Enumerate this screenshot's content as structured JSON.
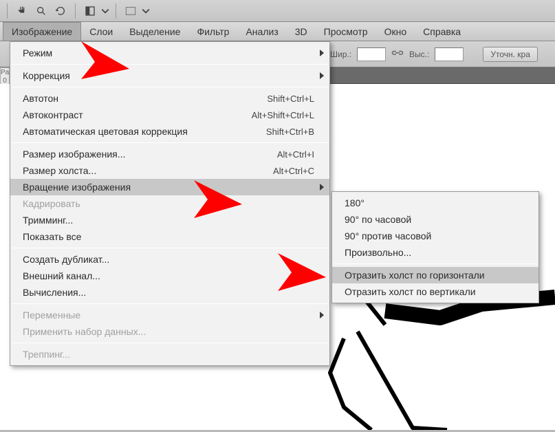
{
  "toolbar_icons": [
    "hand",
    "zoom",
    "rotate-view",
    "sep",
    "screen-mode",
    "chevron",
    "sep",
    "arrange",
    "chevron"
  ],
  "menubar": {
    "items": [
      "Изображение",
      "Слои",
      "Выделение",
      "Фильтр",
      "Анализ",
      "3D",
      "Просмотр",
      "Окно",
      "Справка"
    ],
    "active_index": 0
  },
  "options_bar": {
    "width_label": "Шир.:",
    "height_label": "Выс.:",
    "refine_button": "Уточн. кра"
  },
  "ruler_stub": "Pa\n0",
  "dropdown_main": {
    "groups": [
      [
        {
          "label": "Режим",
          "submenu": true
        }
      ],
      [
        {
          "label": "Коррекция",
          "submenu": true
        }
      ],
      [
        {
          "label": "Автотон",
          "shortcut": "Shift+Ctrl+L"
        },
        {
          "label": "Автоконтраст",
          "shortcut": "Alt+Shift+Ctrl+L"
        },
        {
          "label": "Автоматическая цветовая коррекция",
          "shortcut": "Shift+Ctrl+B"
        }
      ],
      [
        {
          "label": "Размер изображения...",
          "shortcut": "Alt+Ctrl+I"
        },
        {
          "label": "Размер холста...",
          "shortcut": "Alt+Ctrl+C"
        },
        {
          "label": "Вращение изображения",
          "submenu": true,
          "hover": true
        },
        {
          "label": "Кадрировать",
          "disabled": true
        },
        {
          "label": "Тримминг..."
        },
        {
          "label": "Показать все"
        }
      ],
      [
        {
          "label": "Создать дубликат..."
        },
        {
          "label": "Внешний канал..."
        },
        {
          "label": "Вычисления..."
        }
      ],
      [
        {
          "label": "Переменные",
          "submenu": true,
          "disabled": true
        },
        {
          "label": "Применить набор данных...",
          "disabled": true
        }
      ],
      [
        {
          "label": "Треппинг...",
          "disabled": true
        }
      ]
    ]
  },
  "dropdown_sub": {
    "groups": [
      [
        {
          "label": "180°"
        },
        {
          "label": "90° по часовой"
        },
        {
          "label": "90° против часовой"
        },
        {
          "label": "Произвольно..."
        }
      ],
      [
        {
          "label": "Отразить холст по горизонтали",
          "hover": true
        },
        {
          "label": "Отразить холст по вертикали"
        }
      ]
    ]
  }
}
